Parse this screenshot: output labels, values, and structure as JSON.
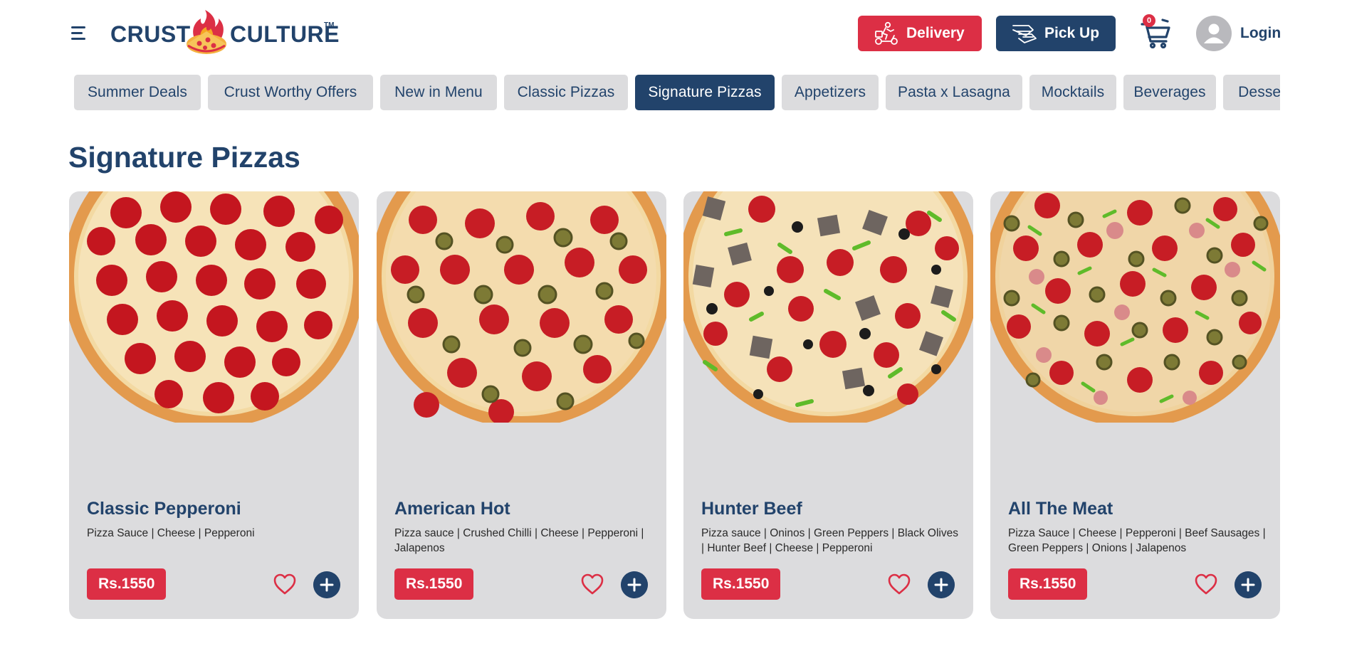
{
  "brand": {
    "name_left": "CRUST",
    "name_right": "CULTURE",
    "trademark": "TM"
  },
  "header": {
    "delivery_label": "Delivery",
    "pickup_label": "Pick Up",
    "cart_count": "0",
    "login_label": "Login"
  },
  "categories": [
    {
      "label": "Summer Deals",
      "active": false
    },
    {
      "label": "Crust Worthy Offers",
      "active": false
    },
    {
      "label": "New in Menu",
      "active": false
    },
    {
      "label": "Classic Pizzas",
      "active": false
    },
    {
      "label": "Signature Pizzas",
      "active": true
    },
    {
      "label": "Appetizers",
      "active": false
    },
    {
      "label": "Pasta x Lasagna",
      "active": false
    },
    {
      "label": "Mocktails",
      "active": false
    },
    {
      "label": "Beverages",
      "active": false
    },
    {
      "label": "Desserts",
      "active": false
    }
  ],
  "section": {
    "title": "Signature Pizzas"
  },
  "products": [
    {
      "name": "Classic Pepperoni",
      "description": "Pizza Sauce | Cheese | Pepperoni",
      "price": "Rs.1550"
    },
    {
      "name": "American Hot",
      "description": "Pizza sauce | Crushed Chilli | Cheese | Pepperoni | Jalapenos",
      "price": "Rs.1550"
    },
    {
      "name": "Hunter Beef",
      "description": "Pizza sauce | Oninos | Green Peppers | Black Olives | Hunter Beef | Cheese | Pepperoni",
      "price": "Rs.1550"
    },
    {
      "name": "All The Meat",
      "description": "Pizza Sauce | Cheese | Pepperoni | Beef Sausages | Green Peppers | Onions | Jalapenos",
      "price": "Rs.1550"
    }
  ],
  "colors": {
    "brand_navy": "#22436b",
    "brand_red": "#dc2f45",
    "chip_gray": "#dcdcde",
    "card_gray": "#dcdcde"
  },
  "icons": {
    "menu": "hamburger-menu-icon",
    "delivery": "delivery-scooter-icon",
    "pickup": "pickup-bag-icon",
    "cart": "shopping-cart-icon",
    "user": "user-avatar-icon",
    "favorite": "heart-outline-icon",
    "add": "plus-circle-icon"
  }
}
